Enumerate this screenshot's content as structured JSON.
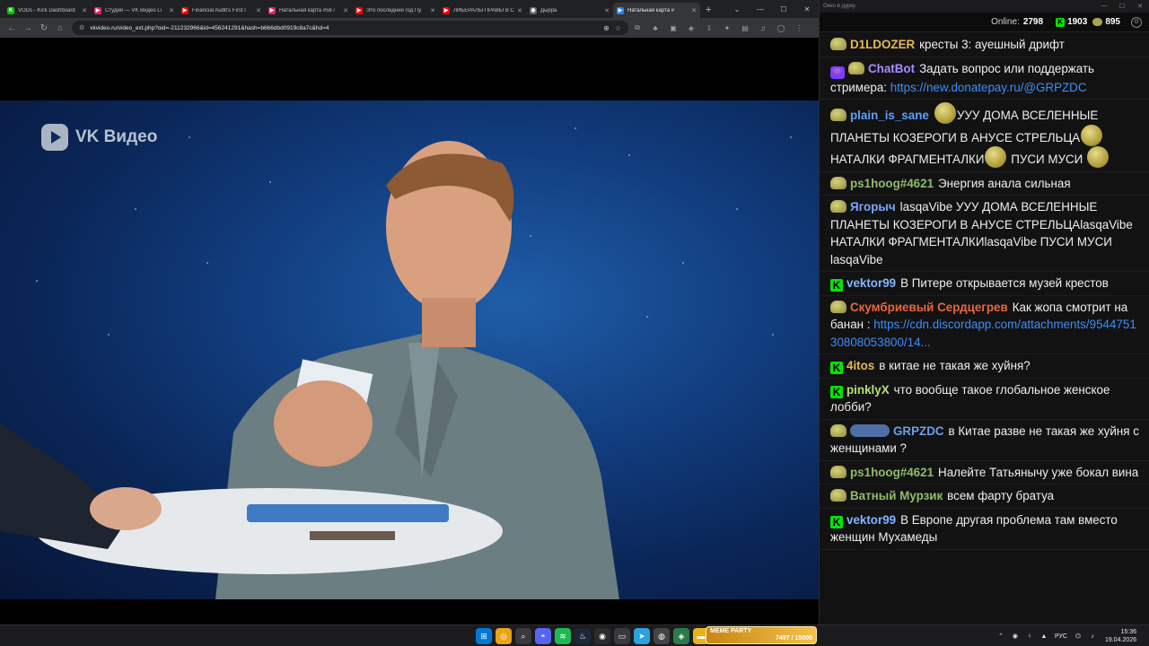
{
  "browser": {
    "tabs": [
      {
        "title": "VODs - Kick Dashboard",
        "fav_color": "#00c400",
        "fav_glyph": "K"
      },
      {
        "title": "Студия — VK Видео Li",
        "fav_color": "#e0245e",
        "fav_glyph": "▶"
      },
      {
        "title": "Financial Audit's First I",
        "fav_color": "#ff0000",
        "fav_glyph": "▶"
      },
      {
        "title": "Натальная карта #58 /",
        "fav_color": "#e0245e",
        "fav_glyph": "▶"
      },
      {
        "title": "Это последний год Пу",
        "fav_color": "#ff0000",
        "fav_glyph": "▶"
      },
      {
        "title": "ЛИБЕРАЛЫ ПРАВЫ В С",
        "fav_color": "#ff0000",
        "fav_glyph": "▶"
      },
      {
        "title": "Дырра",
        "fav_color": "#5f6368",
        "fav_glyph": "◉"
      },
      {
        "title": "Натальная карта #",
        "fav_color": "#2787f5",
        "fav_glyph": "▶",
        "active": true
      }
    ],
    "new_tab": "+",
    "window_controls": {
      "chevron": "⌄",
      "minimize": "—",
      "maximize": "☐",
      "close": "✕"
    },
    "url": "vkvideo.ru/video_ext.php?oid=-211232966&id=456241291&hash=b6b6dbd0919c8a7c&hd=4",
    "toolbar_icons": [
      "zoom-icon",
      "star-icon",
      "extension-icon",
      "download-icon",
      "profile-icon",
      "menu-icon"
    ]
  },
  "video": {
    "watermark": "VK Видео"
  },
  "chat": {
    "window_title": "Окно в дурку",
    "online_label": "Online:",
    "online_count": "2798",
    "kick_count": "1903",
    "emote_count": "895",
    "messages": [
      {
        "badges": [
          "pepe"
        ],
        "user": "D1LDOZER",
        "color": "#e6b94f",
        "text": "кресты 3: ауешный дрифт"
      },
      {
        "badges": [
          "bot",
          "pepe"
        ],
        "user": "ChatBot",
        "color": "#a98bff",
        "text": "Задать вопрос или поддержать стримера: ",
        "link": "https://new.donatepay.ru/@GRPZDC"
      },
      {
        "badges": [
          "pepe"
        ],
        "user": "plain_is_sane",
        "color": "#5aa0ff",
        "parts": [
          "EMOTE",
          "УУУ ДОМА ВСЕЛЕННЫЕ ПЛАНЕТЫ КОЗЕРОГИ В АНУСЕ СТРЕЛЬЦА",
          "EMOTE",
          " НАТАЛКИ ФРАГМЕНТАЛКИ",
          "EMOTE",
          " ПУСИ МУСИ ",
          "EMOTE"
        ]
      },
      {
        "badges": [
          "pepe"
        ],
        "user": "ps1hoog#4621",
        "color": "#8fbc6a",
        "text": "Энергия анала сильная"
      },
      {
        "badges": [
          "pepe"
        ],
        "user": "Ягорыч",
        "color": "#7aa7ff",
        "text": "lasqaVibe УУУ ДОМА ВСЕЛЕННЫЕ ПЛАНЕТЫ КОЗЕРОГИ В АНУСЕ СТРЕЛЬЦАlasqaVibe НАТАЛКИ ФРАГМЕНТАЛКИlasqaVibe ПУСИ МУСИ lasqaVibe"
      },
      {
        "badges": [
          "kick"
        ],
        "user": "vektor99",
        "color": "#82b4ff",
        "text": "В Питере открывается музей крестов"
      },
      {
        "badges": [
          "pepe"
        ],
        "user": "Скумбриевый Сердцегрев",
        "color": "#e8673c",
        "text": "Как жопа смотрит на банан : ",
        "link": "https://cdn.discordapp.com/attachments/954475130808053800/14..."
      },
      {
        "badges": [
          "kick"
        ],
        "user": "4itos",
        "color": "#e6b94f",
        "text": "в китае не такая же хуйня?"
      },
      {
        "badges": [
          "kick"
        ],
        "user": "pinklyX",
        "color": "#b6e07a",
        "text": "что вообще такое глобальное женское лобби?"
      },
      {
        "badges": [
          "pepe",
          "subs"
        ],
        "user": "GRPZDC",
        "color": "#6aa0e8",
        "text": "в Китае разве не такая же хуйня с женщинами ?"
      },
      {
        "badges": [
          "pepe"
        ],
        "user": "ps1hoog#4621",
        "color": "#8fbc6a",
        "text": "Налейте Татьянычу уже бокал вина"
      },
      {
        "badges": [
          "pepe"
        ],
        "user": "Ватный Мурзик",
        "color": "#8fbc6a",
        "text": "всем фарту братуа"
      },
      {
        "badges": [
          "kick"
        ],
        "user": "vektor99",
        "color": "#82b4ff",
        "text": "В Европе другая проблема там вместо женщин Мухамеды"
      }
    ]
  },
  "taskbar": {
    "widget_title": "MEME PARTY",
    "widget_sub": "7497 / 15000",
    "lang": "РУС",
    "time": "15:36",
    "date": "19.04.2026",
    "apps": [
      "windows-icon",
      "chrome-icon",
      "search-icon",
      "discord-icon",
      "spotify-icon",
      "steam-icon",
      "obs-icon",
      "media-icon",
      "telegram-icon",
      "obs-studio-icon",
      "pinned-app-icon",
      "file-explorer-icon"
    ]
  }
}
